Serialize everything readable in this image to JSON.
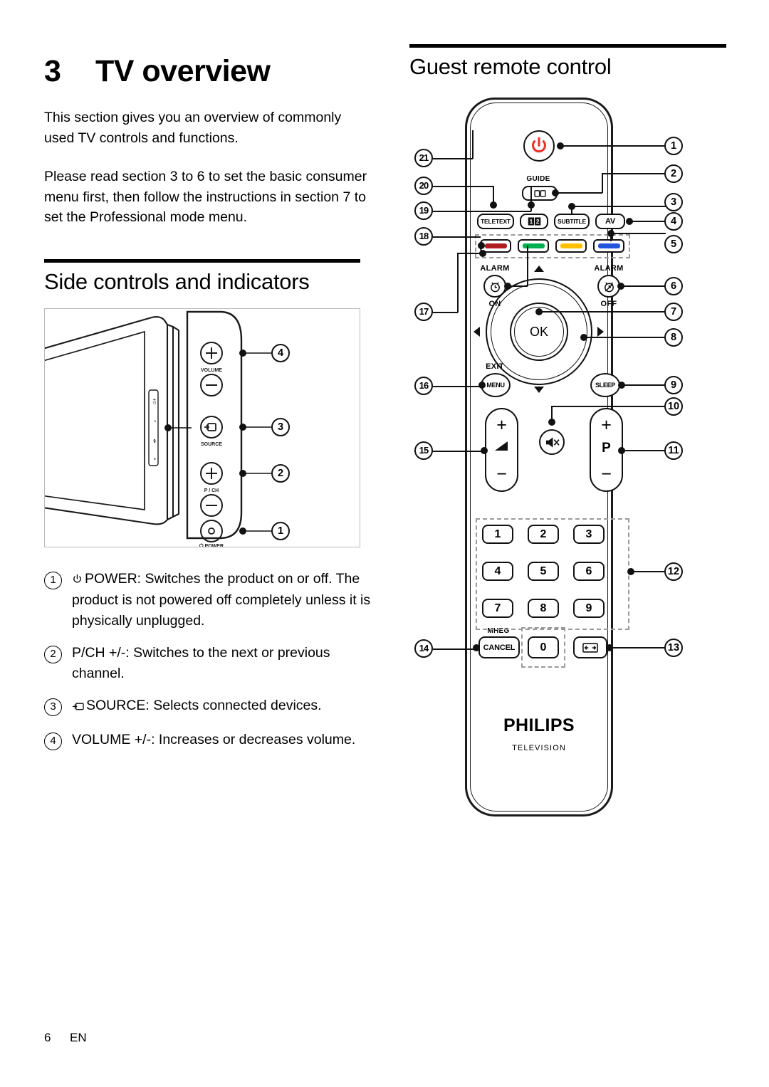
{
  "chapter": {
    "number": "3",
    "title": "TV overview"
  },
  "intro": {
    "paragraph1": "This section gives you an overview of commonly used TV controls and functions.",
    "paragraph2": "Please read section 3 to 6 to set the basic consumer menu first, then follow the instructions in section 7 to set the Professional mode menu."
  },
  "side_controls": {
    "heading": "Side controls and indicators",
    "diagram_labels": {
      "volume": "VOLUME",
      "source": "SOURCE",
      "pch": "P / CH",
      "power": "POWER"
    },
    "callouts": [
      "4",
      "3",
      "2",
      "1"
    ],
    "items": [
      {
        "num": "1",
        "icon": "power-icon",
        "text": "POWER: Switches the product on or off. The product is not powered off completely unless it is physically unplugged."
      },
      {
        "num": "2",
        "icon": "",
        "text": "P/CH +/-: Switches to the next or previous channel."
      },
      {
        "num": "3",
        "icon": "source-icon",
        "text": "SOURCE: Selects connected devices."
      },
      {
        "num": "4",
        "icon": "",
        "text": "VOLUME +/-: Increases or decreases volume."
      }
    ]
  },
  "remote": {
    "heading": "Guest remote control",
    "brand": "PHILIPS",
    "brand_sub": "TELEVISION",
    "buttons": {
      "power": "",
      "guide_label": "GUIDE",
      "teletext": "TELETEXT",
      "dual_screen": "12",
      "subtitle": "SUBTITLE",
      "av": "AV",
      "alarm_left_top": "ALARM",
      "alarm_left_bottom": "ON",
      "alarm_right_top": "ALARM",
      "alarm_right_bottom": "OFF",
      "ok": "OK",
      "exit": "EXIT",
      "menu": "MENU",
      "sleep": "SLEEP",
      "volume_plus": "+",
      "volume_minus": "−",
      "program_plus": "+",
      "program_minus": "−",
      "program_letter": "P",
      "mheg": "MHEG",
      "cancel": "CANCEL",
      "zero": "0"
    },
    "color_keys": [
      {
        "name": "red-key",
        "color": "#b01c22"
      },
      {
        "name": "green-key",
        "color": "#00b050"
      },
      {
        "name": "yellow-key",
        "color": "#ffc000"
      },
      {
        "name": "blue-key",
        "color": "#2255dd"
      }
    ],
    "numeric_keys": [
      "1",
      "2",
      "3",
      "4",
      "5",
      "6",
      "7",
      "8",
      "9"
    ],
    "callouts_right": [
      "1",
      "2",
      "3",
      "4",
      "5",
      "6",
      "7",
      "8",
      "9",
      "10",
      "11",
      "12",
      "13"
    ],
    "callouts_left": [
      "21",
      "20",
      "19",
      "18",
      "17",
      "16",
      "15",
      "14"
    ],
    "power_icon_color": "#e8322a"
  },
  "footer": {
    "page": "6",
    "lang": "EN"
  }
}
